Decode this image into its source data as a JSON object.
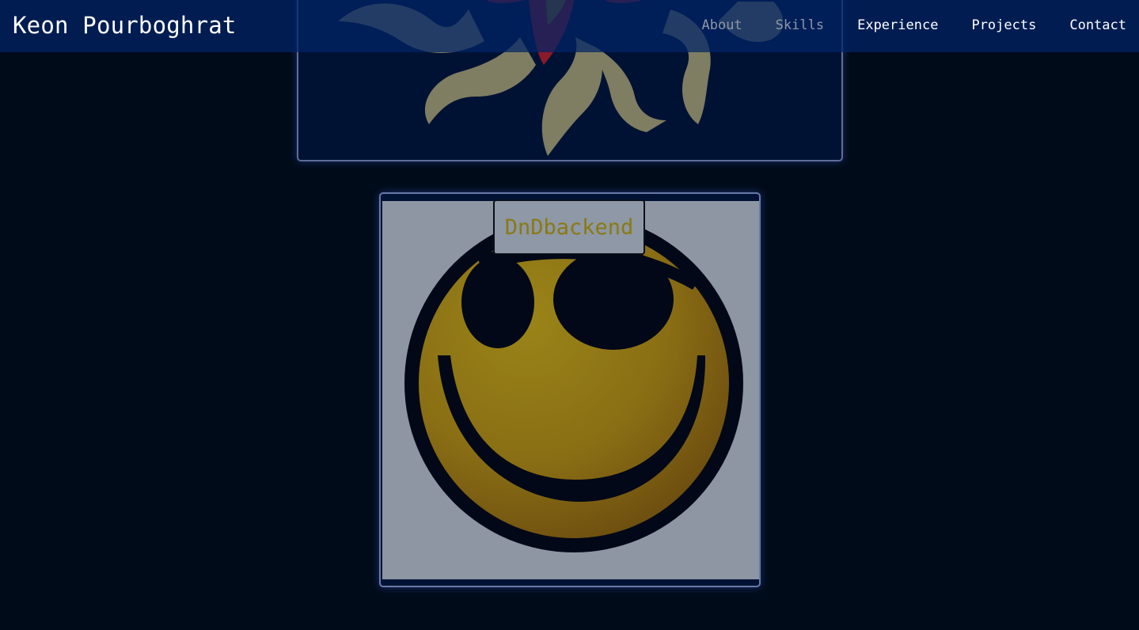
{
  "navbar": {
    "brand": "Keon Pourboghrat",
    "links": [
      {
        "label": "About",
        "state": "dimmed"
      },
      {
        "label": "Skills",
        "state": "dimmed"
      },
      {
        "label": "Experience",
        "state": "active"
      },
      {
        "label": "Projects",
        "state": "active"
      },
      {
        "label": "Contact",
        "state": "active"
      }
    ]
  },
  "projects": {
    "top_card": {
      "image": "sun-logo"
    },
    "main_card": {
      "title": "DnDbackend",
      "image": "pirate-smiley-face"
    }
  },
  "colors": {
    "background": "#000b1a",
    "navbar": "#002366",
    "card_border": "#6879a6",
    "title_text": "#8a7a12"
  }
}
